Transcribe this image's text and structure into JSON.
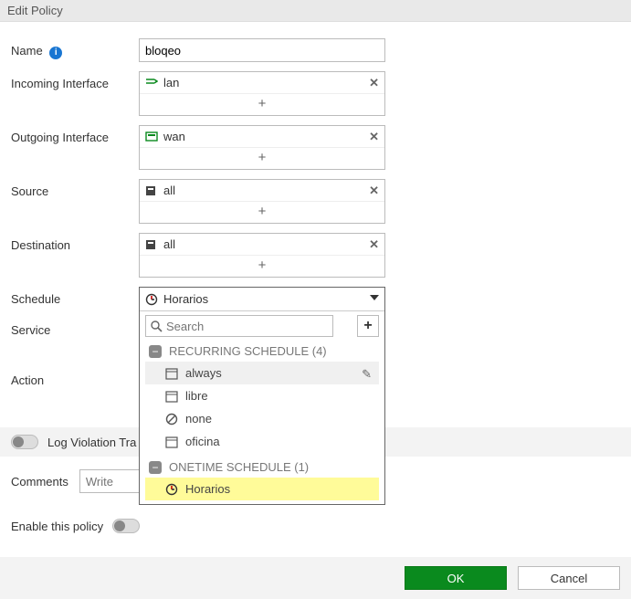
{
  "header": {
    "title": "Edit Policy"
  },
  "labels": {
    "name": "Name",
    "incoming": "Incoming Interface",
    "outgoing": "Outgoing Interface",
    "source": "Source",
    "destination": "Destination",
    "schedule": "Schedule",
    "service": "Service",
    "action": "Action",
    "log_violation": "Log Violation Tra",
    "comments": "Comments",
    "enable": "Enable this policy"
  },
  "fields": {
    "name_value": "bloqeo",
    "incoming_value": "lan",
    "outgoing_value": "wan",
    "source_value": "all",
    "destination_value": "all",
    "comments_placeholder": "Write"
  },
  "schedule": {
    "selected": "Horarios",
    "search_placeholder": "Search",
    "groups": [
      {
        "label": "RECURRING SCHEDULE (4)",
        "items": [
          {
            "name": "always",
            "hover": true,
            "icon": "calendar"
          },
          {
            "name": "libre",
            "icon": "calendar"
          },
          {
            "name": "none",
            "icon": "ban"
          },
          {
            "name": "oficina",
            "icon": "calendar"
          }
        ]
      },
      {
        "label": "ONETIME SCHEDULE (1)",
        "items": [
          {
            "name": "Horarios",
            "selected": true,
            "icon": "clock"
          }
        ]
      }
    ]
  },
  "buttons": {
    "ok": "OK",
    "cancel": "Cancel"
  },
  "glyphs": {
    "plus": "+",
    "minus": "−",
    "remove": "✕",
    "info": "i",
    "magnify": "🔍",
    "edit": "✎"
  }
}
